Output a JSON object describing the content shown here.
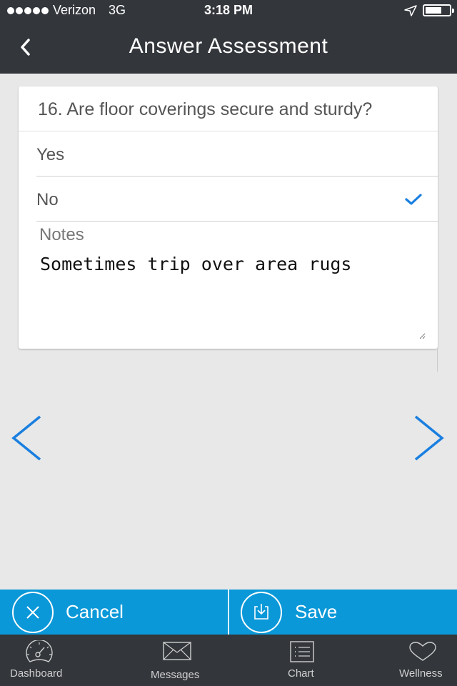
{
  "status_bar": {
    "signal_dots": 5,
    "carrier": "Verizon",
    "network": "3G",
    "time": "3:18 PM",
    "location_icon": "location-arrow-icon",
    "battery_level": 0.7
  },
  "nav": {
    "title": "Answer Assessment",
    "back_icon": "chevron-left-icon"
  },
  "question": {
    "number": 16,
    "text": "16. Are floor coverings secure and sturdy?",
    "options": [
      {
        "label": "Yes",
        "selected": false
      },
      {
        "label": "No",
        "selected": true
      }
    ],
    "notes_label": "Notes",
    "notes_value": "Sometimes trip over area rugs"
  },
  "pager": {
    "prev_icon": "chevron-left-icon",
    "next_icon": "chevron-right-icon"
  },
  "actions": {
    "cancel_label": "Cancel",
    "save_label": "Save"
  },
  "tabs": [
    {
      "label": "Dashboard",
      "icon": "speedometer-icon"
    },
    {
      "label": "Messages",
      "icon": "envelope-icon"
    },
    {
      "label": "Chart",
      "icon": "list-icon"
    },
    {
      "label": "Wellness",
      "icon": "heart-icon"
    }
  ],
  "colors": {
    "accent": "#1a7fe0",
    "action_bar": "#0a98d8",
    "dark_bar": "#33363b",
    "background": "#e8e8e8"
  }
}
